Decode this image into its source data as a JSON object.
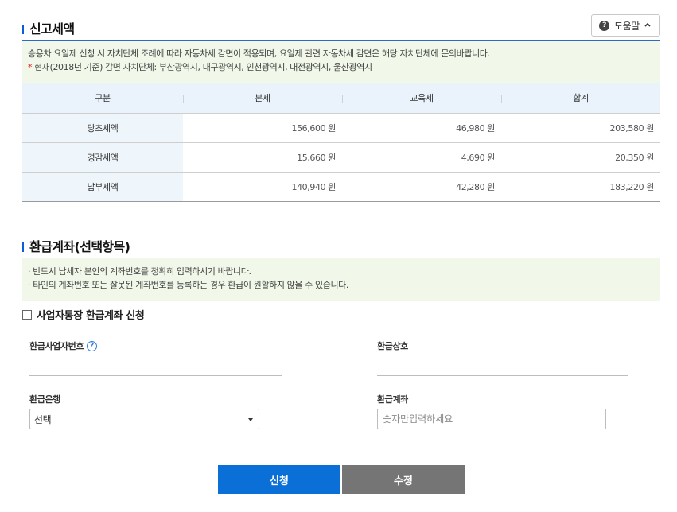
{
  "section1": {
    "title": "신고세액",
    "help_label": "도움말",
    "notice": [
      "승용차 요일제 신청 시 자치단체 조례에 따라 자동차세 감면이 적용되며, 요일제 관련 자동차세 감면은 해당 자치단체에 문의바랍니다.",
      "현재(2018년 기준) 감면 자치단체: 부산광역시, 대구광역시, 인천광역시, 대전광역시, 울산광역시"
    ]
  },
  "tax_table": {
    "headers": [
      "구분",
      "본세",
      "교육세",
      "합계"
    ],
    "rows": [
      {
        "label": "당초세액",
        "base": "156,600 원",
        "edu": "46,980 원",
        "total": "203,580 원"
      },
      {
        "label": "경감세액",
        "base": "15,660 원",
        "edu": "4,690 원",
        "total": "20,350 원"
      },
      {
        "label": "납부세액",
        "base": "140,940 원",
        "edu": "42,280 원",
        "total": "183,220 원"
      }
    ]
  },
  "section2": {
    "title": "환급계좌(선택항목)",
    "notice": [
      "· 반드시 납세자 본인의 계좌번호를 정확히 입력하시기 바랍니다.",
      "· 타인의 계좌번호 또는 잘못된 계좌번호를 등록하는 경우 환급이 원활하지 않을 수 있습니다."
    ],
    "checkbox_label": "사업자통장 환급계좌 신청"
  },
  "form": {
    "biz_no_label": "환급사업자번호",
    "biz_no_value": "",
    "biz_name_label": "환급상호",
    "biz_name_value": "",
    "bank_label": "환급은행",
    "bank_selected": "선택",
    "account_label": "환급계좌",
    "account_placeholder": "숫자만입력하세요"
  },
  "buttons": {
    "apply": "신청",
    "modify": "수정"
  },
  "colors": {
    "primary": "#0a6fd6",
    "secondary": "#757575",
    "notice_bg": "#f1f8ea",
    "header_bg": "#eaf3fb"
  }
}
